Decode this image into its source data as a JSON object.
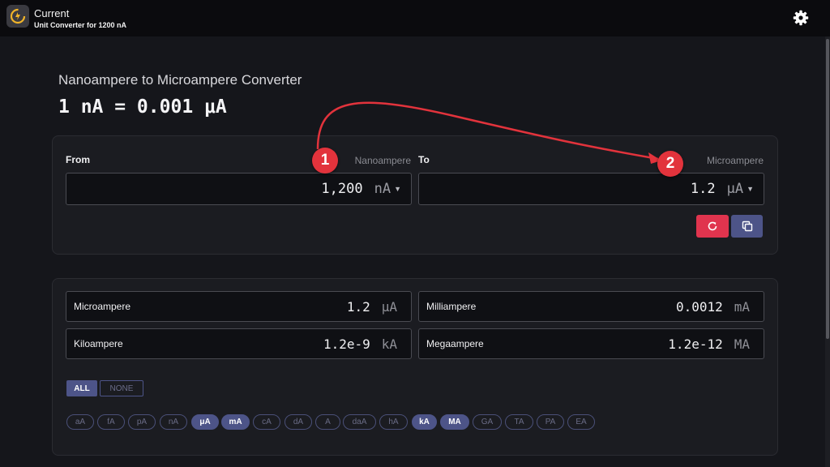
{
  "app": {
    "title": "Current",
    "subtitle": "Unit Converter for 1200 nA",
    "icon": "current-app-icon",
    "settings_icon": "gear-icon"
  },
  "page": {
    "heading": "Nanoampere to Microampere Converter",
    "result_line": "1 nA = 0.001 μA"
  },
  "converter": {
    "from": {
      "label": "From",
      "unit_name": "Nanoampere",
      "value": "1,200",
      "unit": "nA"
    },
    "to": {
      "label": "To",
      "unit_name": "Microampere",
      "value": "1.2",
      "unit": "μA"
    },
    "reset_icon": "refresh-icon",
    "copy_icon": "copy-icon",
    "accent_colors": {
      "reset": "#e0344e",
      "copy": "#4d5488"
    }
  },
  "results": [
    {
      "name": "Microampere",
      "value": "1.2",
      "unit": "μA"
    },
    {
      "name": "Milliampere",
      "value": "0.0012",
      "unit": "mA"
    },
    {
      "name": "Kiloampere",
      "value": "1.2e-9",
      "unit": "kA"
    },
    {
      "name": "Megaampere",
      "value": "1.2e-12",
      "unit": "MA"
    }
  ],
  "filters": {
    "all": "ALL",
    "none": "NONE"
  },
  "chips": [
    {
      "label": "aA",
      "active": false
    },
    {
      "label": "fA",
      "active": false
    },
    {
      "label": "pA",
      "active": false
    },
    {
      "label": "nA",
      "active": false
    },
    {
      "label": "μA",
      "active": true
    },
    {
      "label": "mA",
      "active": true
    },
    {
      "label": "cA",
      "active": false
    },
    {
      "label": "dA",
      "active": false
    },
    {
      "label": "A",
      "active": false
    },
    {
      "label": "daA",
      "active": false
    },
    {
      "label": "hA",
      "active": false
    },
    {
      "label": "kA",
      "active": true
    },
    {
      "label": "MA",
      "active": true
    },
    {
      "label": "GA",
      "active": false
    },
    {
      "label": "TA",
      "active": false
    },
    {
      "label": "PA",
      "active": false
    },
    {
      "label": "EA",
      "active": false
    }
  ],
  "annotations": {
    "badges": [
      "1",
      "2"
    ],
    "color": "#e2333c"
  }
}
